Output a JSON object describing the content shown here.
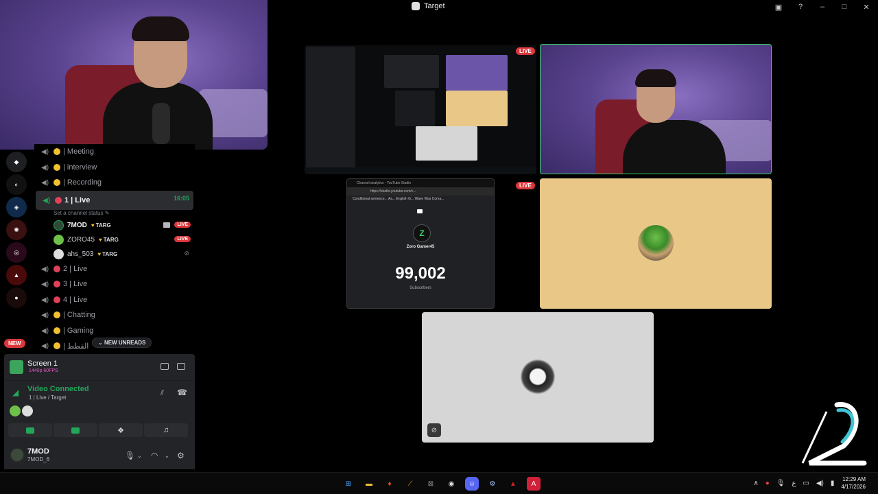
{
  "window": {
    "title": "Target"
  },
  "channels": [
    {
      "name": "| Meeting",
      "dot": "y"
    },
    {
      "name": "| interview",
      "dot": "y"
    },
    {
      "name": "| Recording",
      "dot": "y"
    }
  ],
  "active_channel": {
    "name": "1 | Live",
    "time": "16:05",
    "status_placeholder": "Set a channel status",
    "members": [
      {
        "name": "7MOD",
        "tag": "TARG",
        "live": "LIVE",
        "camera": true
      },
      {
        "name": "ZORO45",
        "tag": "TARG",
        "live": "LIVE",
        "camera": false
      },
      {
        "name": "ahs_503",
        "tag": "TARG",
        "live": "",
        "muted": true
      }
    ]
  },
  "more_channels": [
    {
      "name": "2 | Live",
      "dot": "r"
    },
    {
      "name": "3 | Live",
      "dot": "r"
    },
    {
      "name": "4 | Live",
      "dot": "r"
    },
    {
      "name": "| Chatting",
      "dot": "y"
    },
    {
      "name": "| Gaming",
      "dot": "y"
    },
    {
      "name": "| القطط",
      "dot": "y"
    }
  ],
  "new_badge": "NEW",
  "new_unreads": "NEW UNREADS",
  "screen_panel": {
    "title": "Screen 1",
    "quality": "1440p 60FPS"
  },
  "voice_panel": {
    "status": "Video Connected",
    "location": "1 | Live / Target"
  },
  "user_panel": {
    "display_name": "7MOD",
    "handle": "7MOD_6"
  },
  "stage": {
    "screen_live": "LIVE",
    "stream_live": "LIVE",
    "stream": {
      "tab_title": "Channel analytics - YouTube Studio",
      "url": "https://studio.youtube.com/c...",
      "bookmarks": "Conditional sentence...   As...   English G...   Wave Was Coma...",
      "channel_name": "Zoro Gamer45",
      "subscriber_count": "99,002",
      "subscriber_label": "Subscribers"
    }
  },
  "taskbar": {
    "time": "12:29 AM",
    "date": "4/17/2026",
    "lang": "ع"
  },
  "colors": {
    "accent_green": "#23a55a",
    "live_red": "#da373c",
    "zoro_bg": "#e8c787",
    "ahs_bg": "#d6d6d6"
  }
}
